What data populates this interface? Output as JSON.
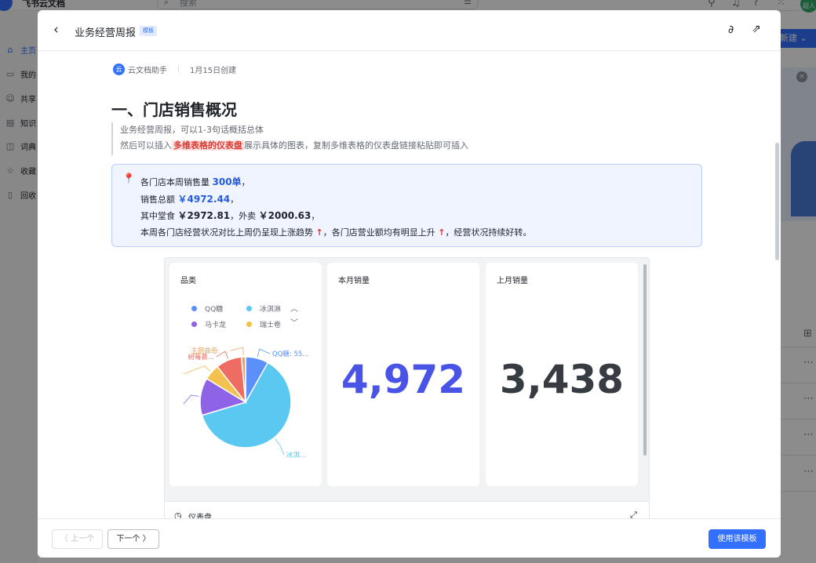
{
  "background": {
    "app_name": "飞书云文档",
    "search_placeholder": "搜索",
    "new_button": "新建 ⌄",
    "avatar_text": "超人",
    "sidebar": [
      {
        "label": "主页",
        "icon": "home-icon",
        "active": true
      },
      {
        "label": "我的",
        "icon": "folder-icon"
      },
      {
        "label": "共享",
        "icon": "users-icon"
      },
      {
        "label": "知识",
        "icon": "book-icon"
      },
      {
        "label": "词典",
        "icon": "dictionary-icon"
      },
      {
        "label": "收藏",
        "icon": "star-icon"
      },
      {
        "label": "回收",
        "icon": "trash-icon"
      }
    ]
  },
  "modal": {
    "title": "业务经营周报",
    "tag": "模板",
    "author": "云文档助手",
    "author_avatar": "云",
    "created": "1月15日创建",
    "heading": "一、门店销售概况",
    "quote": {
      "line1": "业务经营周报，可以1-3句话概括总体",
      "line2_pre": "然后可以插入",
      "line2_hl": "多维表格的仪表盘",
      "line2_post": "展示具体的图表，复制多维表格的仪表盘链接粘贴即可插入"
    },
    "callout": {
      "l1_pre": "各门店本周销售量 ",
      "l1_num": "300单",
      "l1_post": "，",
      "l2_pre": "销售总额 ",
      "l2_num": "￥4972.44",
      "l2_post": "，",
      "l3_pre": "其中堂食 ",
      "l3_num1": "￥2972.81",
      "l3_mid": "，外卖 ",
      "l3_num2": "￥2000.63",
      "l3_post": "，",
      "l4_a": "本周各门店经营状况对比上周仍呈现上涨趋势 ",
      "l4_arrow1": "↑",
      "l4_b": "，各门店营业额均有明显上升 ",
      "l4_arrow2": "↑",
      "l4_c": "，经营状况持续好转。"
    },
    "dashboard": {
      "footer_label": "仪表盘",
      "card_category_title": "品类",
      "card_this_month_title": "本月销量",
      "card_this_month_value": "4,972",
      "card_last_month_title": "上月销量",
      "card_last_month_value": "3,438",
      "pie_labels": {
        "qq": "QQ糖: 55...",
        "ice": "冰淇...",
        "top1": "主厨曲奇: ...",
        "top2": "树莓慕..."
      }
    },
    "footer": {
      "prev": "〈 上一个",
      "next": "下一个 〉",
      "use": "使用该模板"
    }
  },
  "chart_data": {
    "type": "pie",
    "title": "品类",
    "legend_position": "top",
    "series": [
      {
        "name": "QQ糖",
        "value": 55,
        "color": "#5b8ff9"
      },
      {
        "name": "冰淇淋",
        "value": 420,
        "color": "#5ac8f0"
      },
      {
        "name": "马卡龙",
        "value": 90,
        "color": "#8f63e6"
      },
      {
        "name": "瑞士卷",
        "value": 38,
        "color": "#f2c14e"
      },
      {
        "name": "主厨曲奇",
        "value": 62,
        "color": "#ee6c62"
      },
      {
        "name": "树莓慕斯",
        "value": 10,
        "color": "#f0a05a"
      }
    ],
    "legend_visible": [
      "QQ糖",
      "冰淇淋",
      "马卡龙",
      "瑞士卷"
    ]
  }
}
